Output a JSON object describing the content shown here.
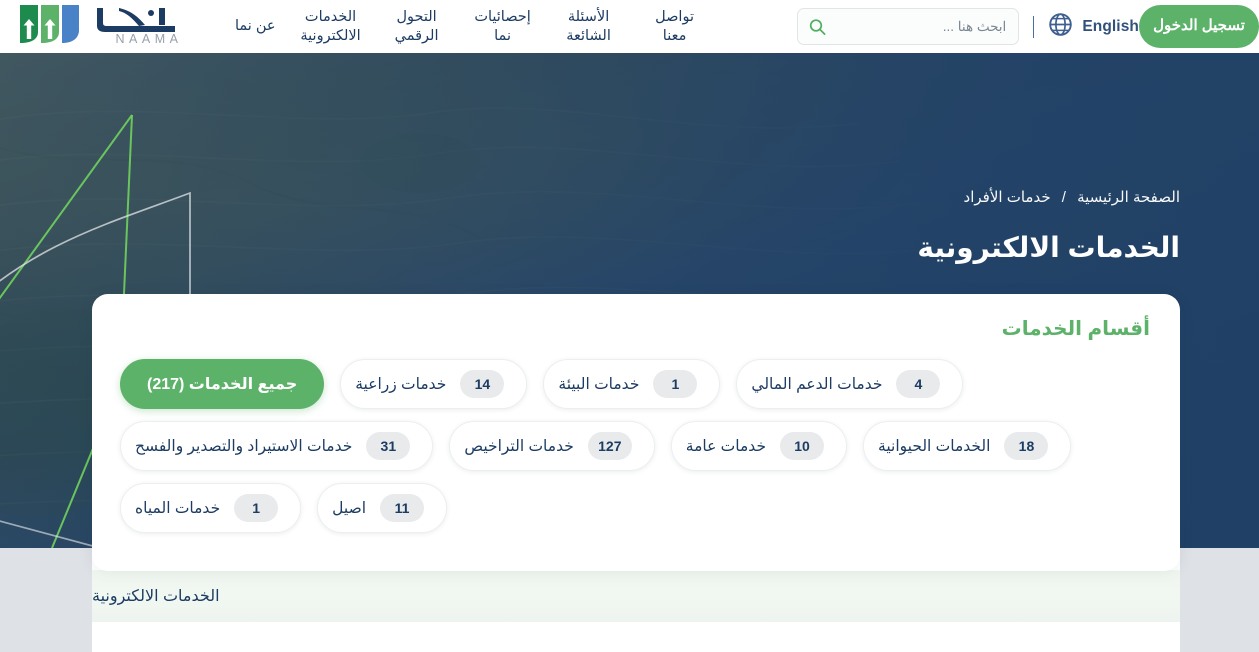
{
  "navbar": {
    "brand": {
      "logo_mark": "naama-logo-icon",
      "wordmark": "NAAMA",
      "arabic_mark": "نما"
    },
    "links": [
      {
        "label": "عن نما",
        "name": "nav-about"
      },
      {
        "label": "الخدمات الالكترونية",
        "name": "nav-eservices"
      },
      {
        "label": "التحول الرقمي",
        "name": "nav-digital-transformation"
      },
      {
        "label": "إحصائيات نما",
        "name": "nav-statistics"
      },
      {
        "label": "الأسئلة الشائعة",
        "name": "nav-faq"
      },
      {
        "label": "تواصل معنا",
        "name": "nav-contact"
      }
    ],
    "search": {
      "placeholder": "ابحث هنا ...",
      "value": "",
      "icon": "search-icon"
    },
    "language": {
      "label": "English",
      "icon": "globe-icon"
    },
    "login_label": "تسجيل الدخول"
  },
  "hero": {
    "breadcrumb": [
      {
        "label": "الصفحة الرئيسية",
        "name": "breadcrumb-home"
      },
      {
        "label": "خدمات الأفراد",
        "name": "breadcrumb-individual-services"
      }
    ],
    "breadcrumb_separator": "/",
    "title": "الخدمات الالكترونية"
  },
  "categories": {
    "title": "أقسام الخدمات",
    "rows": [
      [
        {
          "label": "جميع الخدمات (217)",
          "count": null,
          "active": true,
          "name": "category-all-services"
        },
        {
          "label": "خدمات زراعية",
          "count": "14",
          "active": false,
          "name": "category-agricultural-services"
        },
        {
          "label": "خدمات البيئة",
          "count": "1",
          "active": false,
          "name": "category-environment-services"
        },
        {
          "label": "خدمات الدعم المالي",
          "count": "4",
          "active": false,
          "name": "category-financial-support-services"
        }
      ],
      [
        {
          "label": "خدمات الاستيراد والتصدير والفسح",
          "count": "31",
          "active": false,
          "name": "category-import-export-clearance-services"
        },
        {
          "label": "خدمات التراخيص",
          "count": "127",
          "active": false,
          "name": "category-licensing-services"
        },
        {
          "label": "خدمات عامة",
          "count": "10",
          "active": false,
          "name": "category-general-services"
        },
        {
          "label": "الخدمات الحيوانية",
          "count": "18",
          "active": false,
          "name": "category-animal-services"
        }
      ],
      [
        {
          "label": "خدمات المياه",
          "count": "1",
          "active": false,
          "name": "category-water-services"
        },
        {
          "label": "اصيل",
          "count": "11",
          "active": false,
          "name": "category-aseel"
        }
      ]
    ]
  },
  "lower_section": {
    "band_title": "الخدمات الالكترونية"
  },
  "colors": {
    "brand_green": "#5cb269",
    "logo_dark_green": "#1d8a4e",
    "logo_light_green": "#5cb269",
    "logo_blue": "#4a82c8",
    "navy_text": "#1d3c63",
    "page_bg": "#dee1e5",
    "band_bg": "#f1f7f0",
    "chip_count_bg": "#e9eaec"
  }
}
